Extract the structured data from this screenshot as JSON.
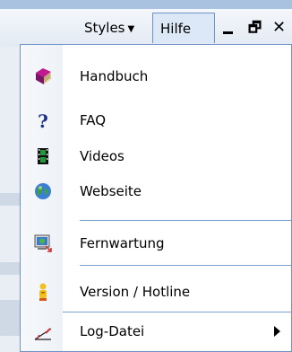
{
  "menubar": {
    "styles_label": "Styles",
    "hilfe_label": "Hilfe"
  },
  "window_controls": {
    "restore_glyph": "🗗",
    "close_glyph": "✕"
  },
  "hilfe_menu": {
    "items": [
      {
        "label": "Handbuch",
        "icon": "book-icon"
      },
      {
        "label": "FAQ",
        "icon": "question-mark-icon"
      },
      {
        "label": "Videos",
        "icon": "film-icon"
      },
      {
        "label": "Webseite",
        "icon": "globe-icon"
      },
      {
        "label": "Fernwartung",
        "icon": "remote-monitor-icon"
      },
      {
        "label": "Version / Hotline",
        "icon": "person-info-icon"
      },
      {
        "label": "Log-Datei",
        "icon": "log-chart-icon",
        "has_submenu": true
      }
    ]
  },
  "colors": {
    "menu_border": "#6f93c6",
    "separator": "#7ea0cf",
    "header_highlight": "#dde8f6"
  }
}
